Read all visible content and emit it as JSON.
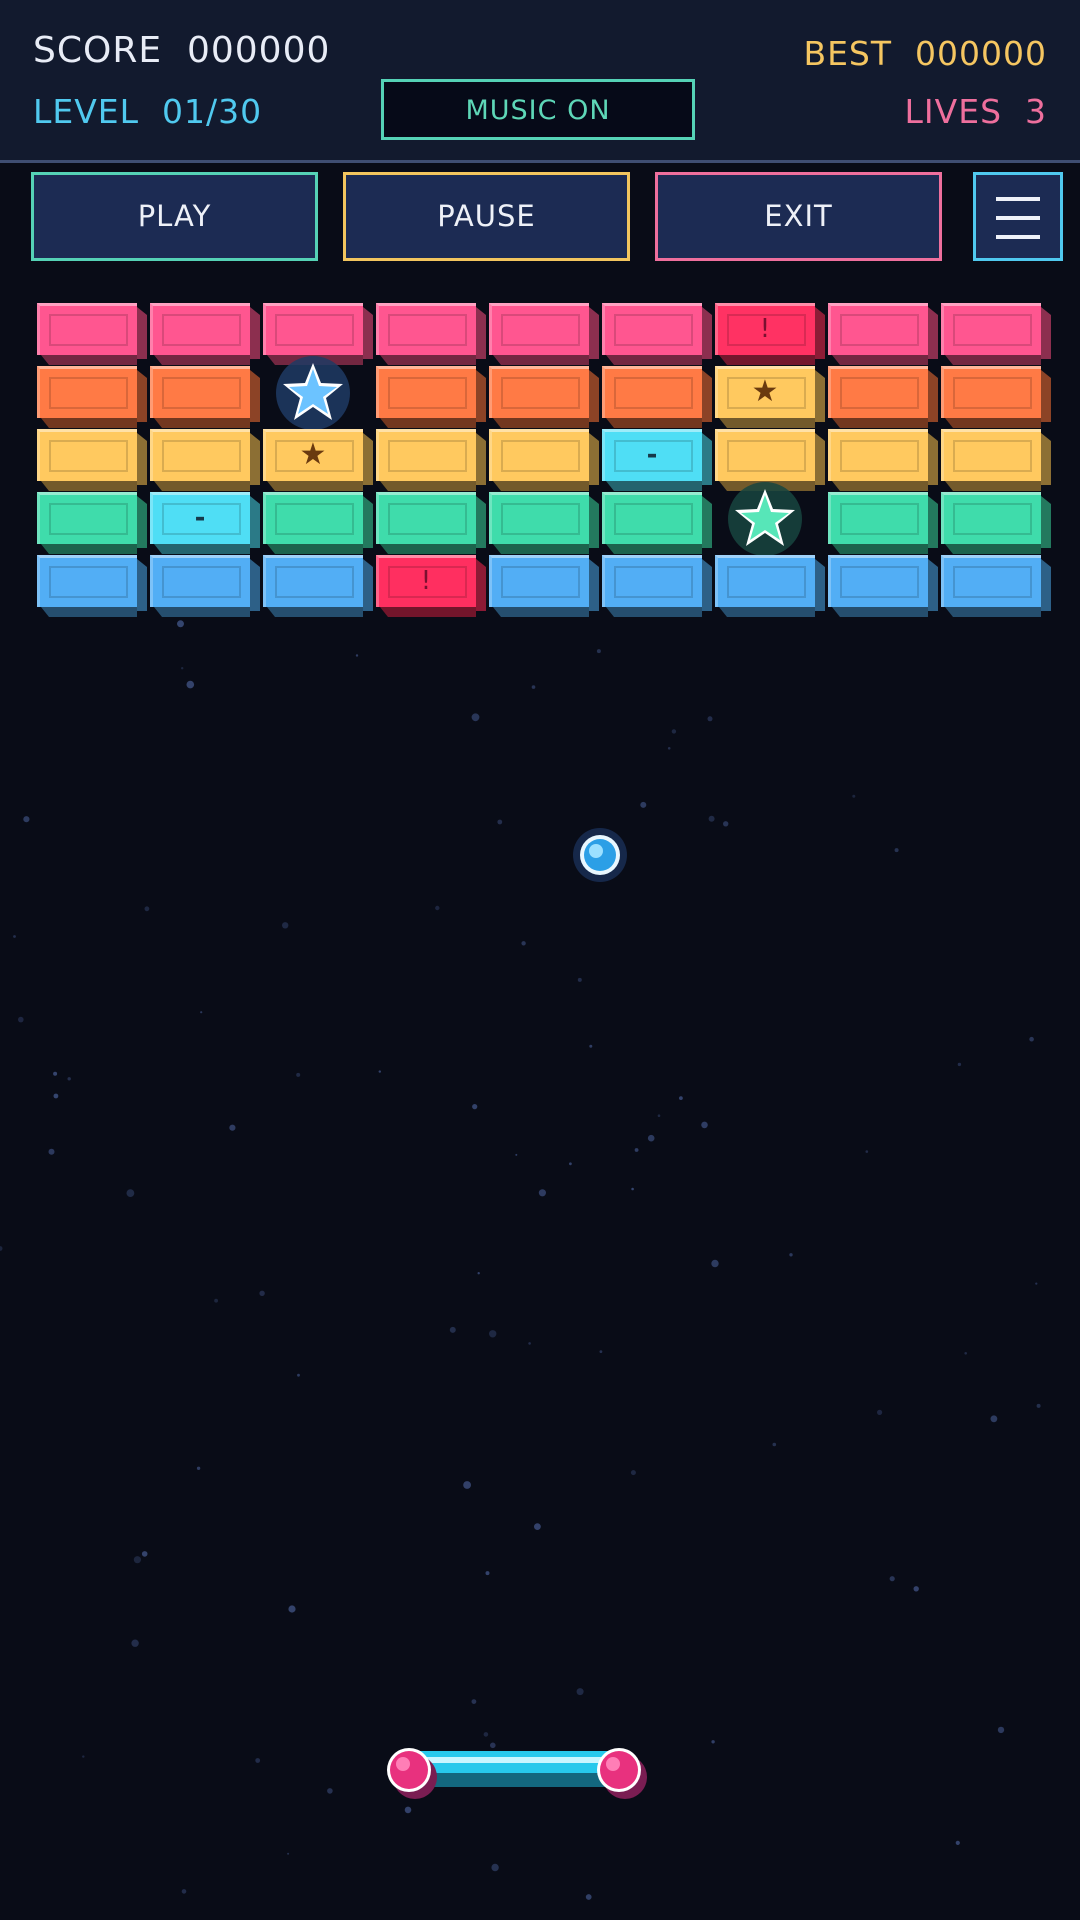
{
  "hud": {
    "score": "SCORE  000000",
    "best": "BEST  000000",
    "level": "LEVEL  01/30",
    "lives": "LIVES  3",
    "music": "MUSIC  ON"
  },
  "buttons": {
    "play": "PLAY",
    "pause": "PAUSE",
    "exit": "EXIT",
    "menu_icon": "hamburger-icon"
  },
  "colors": {
    "pink": "#ff5690",
    "orange": "#ff7a45",
    "yellow": "#ffc95f",
    "green": "#3fdcab",
    "blue": "#52aef5",
    "cyan": "#4fdef5",
    "red": "#ff3263"
  },
  "brick_grid": [
    [
      "pink",
      "pink",
      "pink",
      "pink",
      "pink",
      "pink",
      "red:!",
      "pink",
      "pink"
    ],
    [
      "orange",
      "orange",
      "star-blue",
      "orange",
      "orange",
      "orange",
      "yellow:★",
      "orange",
      "orange"
    ],
    [
      "yellow",
      "yellow",
      "yellow:★",
      "yellow",
      "yellow",
      "cyan:-",
      "yellow",
      "yellow",
      "yellow"
    ],
    [
      "green",
      "cyan:-",
      "green",
      "green",
      "green",
      "green",
      "star-green",
      "green",
      "green"
    ],
    [
      "blue",
      "blue",
      "blue",
      "pink-red:!",
      "blue",
      "blue",
      "blue",
      "blue",
      "blue"
    ]
  ]
}
